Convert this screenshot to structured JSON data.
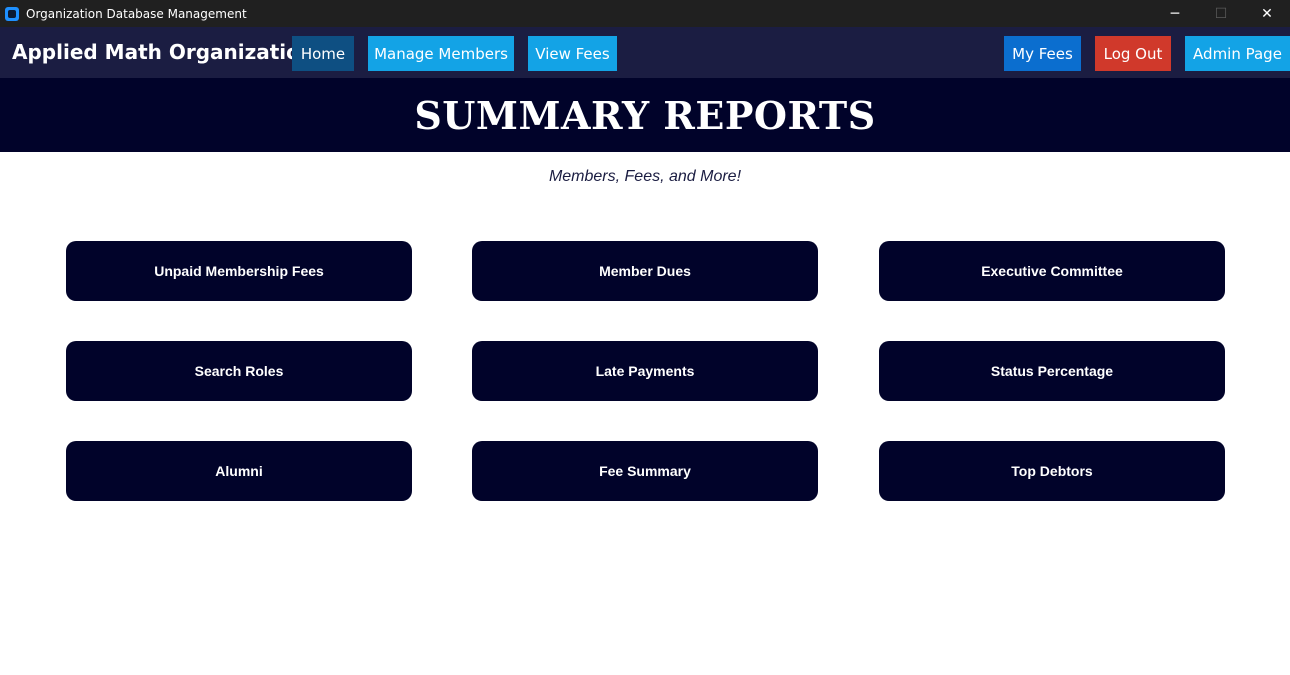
{
  "window": {
    "title": "Organization Database Management",
    "icon": "app-icon",
    "controls": {
      "minimize": "─",
      "maximize": "☐",
      "close": "✕"
    }
  },
  "navbar": {
    "brand": "Applied Math Organization",
    "left_items": {
      "home": "Home",
      "manage_members": "Manage Members",
      "view_fees": "View Fees"
    },
    "right_items": {
      "my_fees": "My Fees",
      "log_out": "Log Out",
      "admin_page": "Admin Page"
    },
    "colors": {
      "bar": "#1b1d42",
      "active": "#0e4f82",
      "primary": "#13a3e6",
      "my_fees": "#0b6ecf",
      "danger": "#d0392b"
    }
  },
  "header": {
    "title": "SUMMARY REPORTS",
    "subtitle": "Members, Fees, and More!",
    "background": "#01032a"
  },
  "reports": {
    "unpaid_membership_fees": "Unpaid Membership Fees",
    "member_dues": "Member Dues",
    "executive_committee": "Executive Committee",
    "search_roles": "Search Roles",
    "late_payments": "Late Payments",
    "status_percentage": "Status Percentage",
    "alumni": "Alumni",
    "fee_summary": "Fee Summary",
    "top_debtors": "Top Debtors"
  }
}
